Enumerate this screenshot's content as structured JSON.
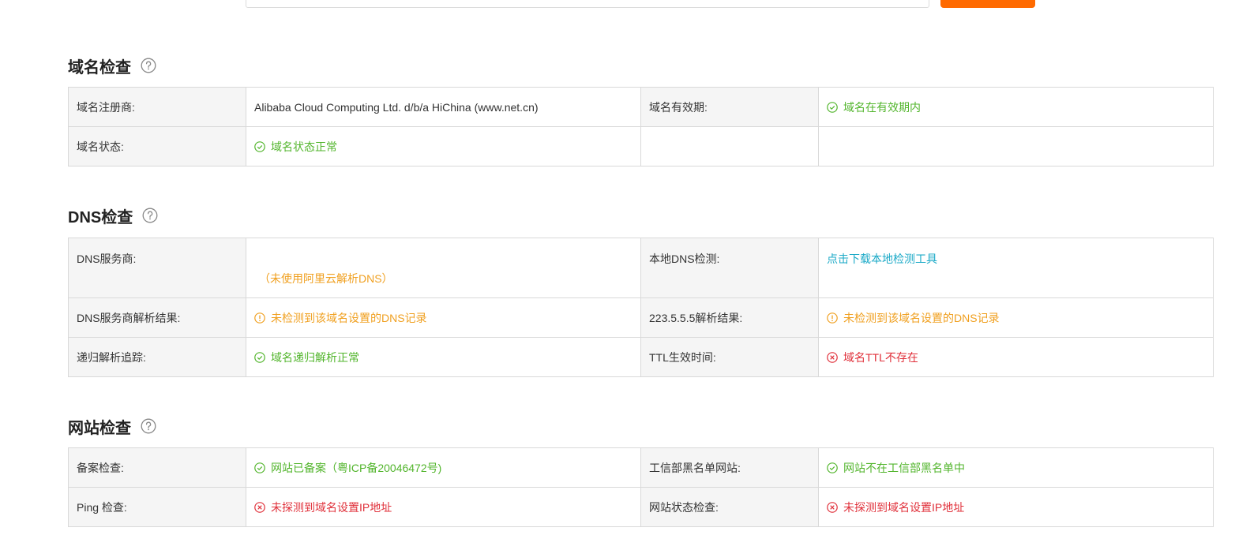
{
  "search": {
    "placeholder": ""
  },
  "colors": {
    "ok": "#52b52c",
    "warn": "#f0a020",
    "error": "#e0303a",
    "link": "#1aa9c7",
    "accent": "#ff6a00"
  },
  "domain_check": {
    "title": "域名检查",
    "registrar_label": "域名注册商:",
    "registrar_value": "Alibaba Cloud Computing Ltd. d/b/a HiChina (www.net.cn)",
    "expiry_label": "域名有效期:",
    "expiry_value": "域名在有效期内",
    "status_label": "域名状态:",
    "status_value": "域名状态正常"
  },
  "dns_check": {
    "title": "DNS检查",
    "provider_label": "DNS服务商:",
    "provider_note": "（未使用阿里云解析DNS）",
    "local_label": "本地DNS检测:",
    "local_link": "点击下载本地检测工具",
    "provider_result_label": "DNS服务商解析结果:",
    "provider_result_value": "未检测到该域名设置的DNS记录",
    "public_result_label": "223.5.5.5解析结果:",
    "public_result_value": "未检测到该域名设置的DNS记录",
    "recursion_label": "递归解析追踪:",
    "recursion_value": "域名递归解析正常",
    "ttl_label": "TTL生效时间:",
    "ttl_value": "域名TTL不存在"
  },
  "site_check": {
    "title": "网站检查",
    "icp_label": "备案检查:",
    "icp_value": "网站已备案（粤ICP备20046472号)",
    "blacklist_label": "工信部黑名单网站:",
    "blacklist_value": "网站不在工信部黑名单中",
    "ping_label": "Ping 检查:",
    "ping_value": "未探测到域名设置IP地址",
    "status_label": "网站状态检查:",
    "status_value": "未探测到域名设置IP地址"
  },
  "icons": {
    "help": "question-circle",
    "ok": "check-circle",
    "warn": "exclamation-circle",
    "error": "x-circle"
  }
}
